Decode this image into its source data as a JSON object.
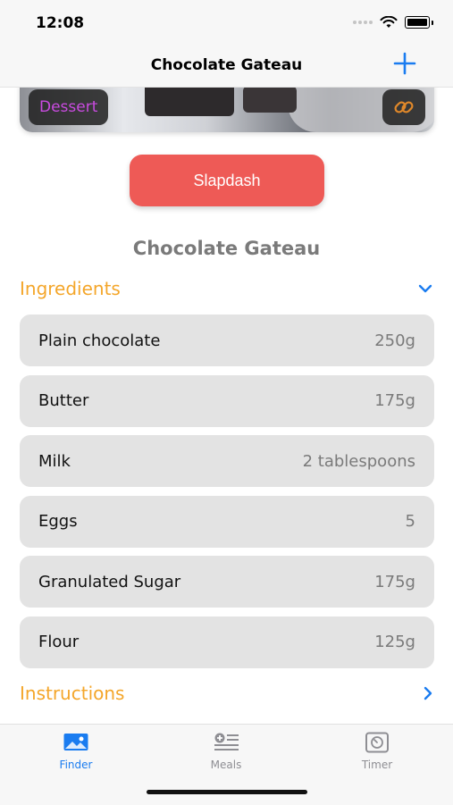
{
  "status": {
    "time": "12:08"
  },
  "nav": {
    "title": "Chocolate Gateau",
    "add_icon": "plus-icon"
  },
  "hero": {
    "badge": "Dessert",
    "link_icon": "link-icon"
  },
  "action": {
    "label": "Slapdash"
  },
  "recipe": {
    "title": "Chocolate Gateau"
  },
  "ingredients": {
    "header": "Ingredients",
    "items": [
      {
        "name": "Plain chocolate",
        "qty": "250g"
      },
      {
        "name": "Butter",
        "qty": "175g"
      },
      {
        "name": "Milk",
        "qty": "2 tablespoons"
      },
      {
        "name": "Eggs",
        "qty": "5"
      },
      {
        "name": "Granulated Sugar",
        "qty": "175g"
      },
      {
        "name": "Flour",
        "qty": "125g"
      }
    ]
  },
  "instructions": {
    "header": "Instructions"
  },
  "tabs": [
    {
      "label": "Finder",
      "icon": "photo-icon",
      "active": true
    },
    {
      "label": "Meals",
      "icon": "list-add-icon",
      "active": false
    },
    {
      "label": "Timer",
      "icon": "timer-icon",
      "active": false
    }
  ],
  "colors": {
    "accent": "#1a7cf0",
    "section": "#f4a62a",
    "button": "#ee5a56",
    "badge": "#c94be0",
    "link": "#e0882a"
  }
}
